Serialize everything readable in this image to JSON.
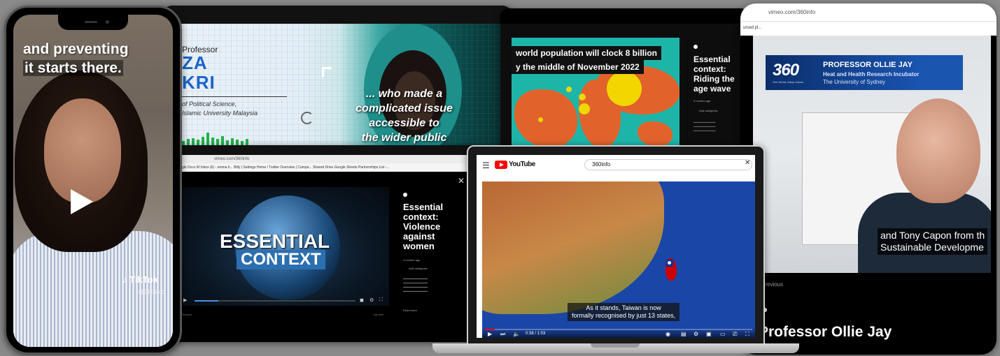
{
  "monitor_left": {
    "kicker": "Professor",
    "name_line1": "ZA",
    "name_line2": "KRI",
    "role_line1": "of Political Science,",
    "role_line2": "Islamic University Malaysia",
    "quote_line1": "... who made a",
    "quote_line2": "complicated issue",
    "quote_line3": "accessible to",
    "quote_line4": "the wider public",
    "accent_color": "#1b64c8"
  },
  "monitor_mid": {
    "caption_line1": "world population will clock 8 billion",
    "caption_line2": "y the middle of November 2022",
    "title": "Essential context: Riding the age wave",
    "meta": "4 months ago",
    "category": "Add categories"
  },
  "tablet": {
    "url": "vimeo.com/360info",
    "subbar_text": "urced pl...",
    "logo": "360",
    "logo_sub": "One World, Many Voices",
    "lt_name": "PROFESSOR OLLIE JAY",
    "lt_sub1": "Heat and Health Research Incubator",
    "lt_sub2": "The University of Sydney",
    "subtitle_line1": "and Tony Capon from th",
    "subtitle_line2": "Sustainable Developme",
    "previous": "Previous",
    "title": "Professor Ollie Jay"
  },
  "browser": {
    "url": "vimeo.com/360info",
    "bookmarks": "gle Docs  M Inbox (6) - emma.h...  Billy | Settings  Home / Twitter  Overview | Campa...  Shared Drive  Google Sheets  Partnerships List -...",
    "player_line1": "ESSENTIAL",
    "player_line2": "CONTEXT",
    "title": "Essential context: Violence against women",
    "meta": "4 months ago",
    "category": "Add categories",
    "read_more": "Read more",
    "prev": "Previous",
    "next": "Up next",
    "close": "✕"
  },
  "laptop": {
    "brand": "YouTube",
    "search": "360info",
    "subtitle_line1": "As it stands, Taiwan is now",
    "subtitle_line2": "formally recognised by just 13 states,",
    "time": "0:38 / 1:03"
  },
  "phone": {
    "caption_line1": "and preventing",
    "caption_line2": "it starts there.",
    "brand": "TikTok",
    "handle": "@360info"
  }
}
